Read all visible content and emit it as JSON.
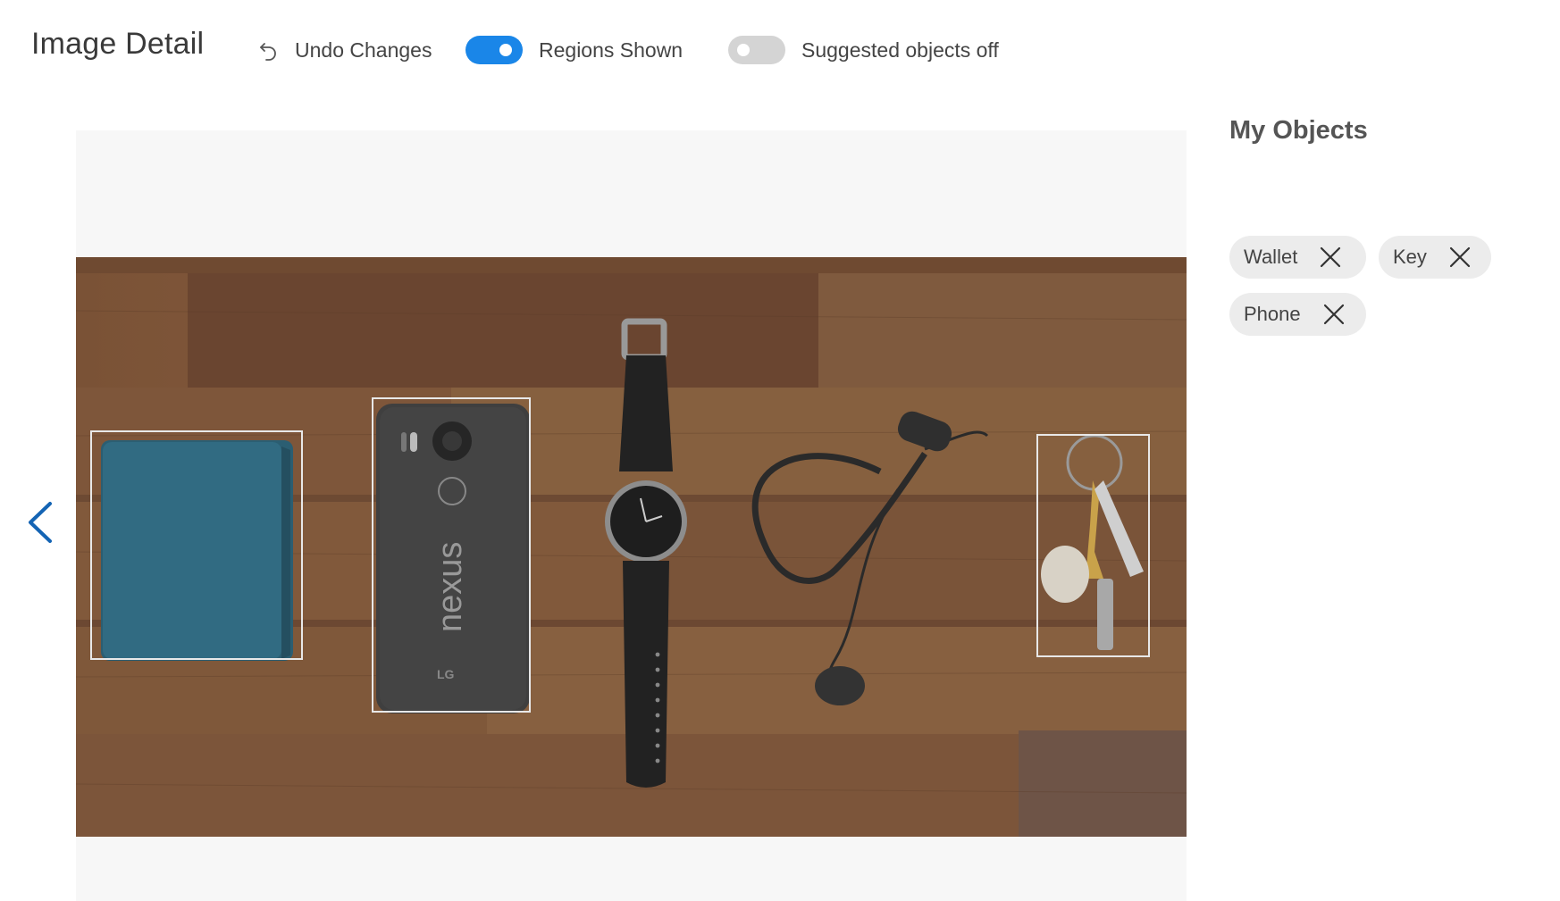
{
  "header": {
    "title": "Image Detail",
    "undo_label": "Undo Changes",
    "undo_icon": "undo-icon",
    "regions_toggle": {
      "label": "Regions Shown",
      "on": true
    },
    "suggested_toggle": {
      "label": "Suggested objects off",
      "on": false
    }
  },
  "colors": {
    "accent": "#1a86e8",
    "nav_arrow": "#1464b4",
    "chip_bg": "#ececec",
    "region_border": "#e8e8e8"
  },
  "viewer": {
    "prev_icon": "chevron-left-icon",
    "photo": {
      "description_objects": [
        "wallet",
        "phone",
        "watch",
        "earphones",
        "keys"
      ],
      "phone_text": "nexus",
      "phone_brand": "LG"
    },
    "regions": [
      {
        "object": "Wallet"
      },
      {
        "object": "Phone"
      },
      {
        "object": "Key"
      }
    ]
  },
  "sidebar": {
    "title": "My Objects",
    "objects": [
      {
        "label": "Wallet",
        "remove_icon": "close-icon"
      },
      {
        "label": "Key",
        "remove_icon": "close-icon"
      },
      {
        "label": "Phone",
        "remove_icon": "close-icon"
      }
    ]
  }
}
